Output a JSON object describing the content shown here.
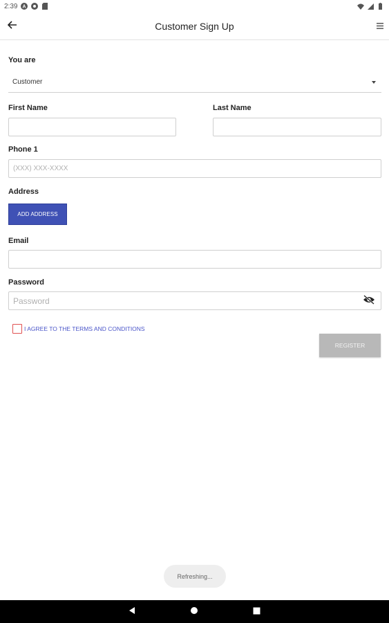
{
  "status_bar": {
    "time": "2:39",
    "left_icons": [
      "a-icon",
      "record-icon",
      "sd-card-icon"
    ],
    "right_icons": [
      "wifi-icon",
      "signal-icon",
      "battery-icon"
    ]
  },
  "app_bar": {
    "title": "Customer Sign Up",
    "back_icon": "arrow-back-icon",
    "menu_icon": "hamburger-menu-icon"
  },
  "form": {
    "role_label": "You are",
    "role_value": "Customer",
    "first_name_label": "First Name",
    "first_name_value": "",
    "last_name_label": "Last Name",
    "last_name_value": "",
    "phone_label": "Phone 1",
    "phone_placeholder": "(XXX) XXX-XXXX",
    "address_label": "Address",
    "add_address_button": "ADD ADDRESS",
    "email_label": "Email",
    "email_value": "",
    "password_label": "Password",
    "password_placeholder": "Password",
    "terms_text": "I AGREE TO THE TERMS AND CONDITIONS",
    "terms_checked": false,
    "register_button": "REGISTER"
  },
  "toast": {
    "text": "Refreshing..."
  },
  "nav_bar": {
    "buttons": [
      "back-triangle-icon",
      "home-circle-icon",
      "recents-square-icon"
    ]
  },
  "colors": {
    "accent": "#3f51b5",
    "checkbox_border": "#e05050",
    "terms_link": "#4a55c9",
    "register_disabled": "#b8b8b8"
  }
}
